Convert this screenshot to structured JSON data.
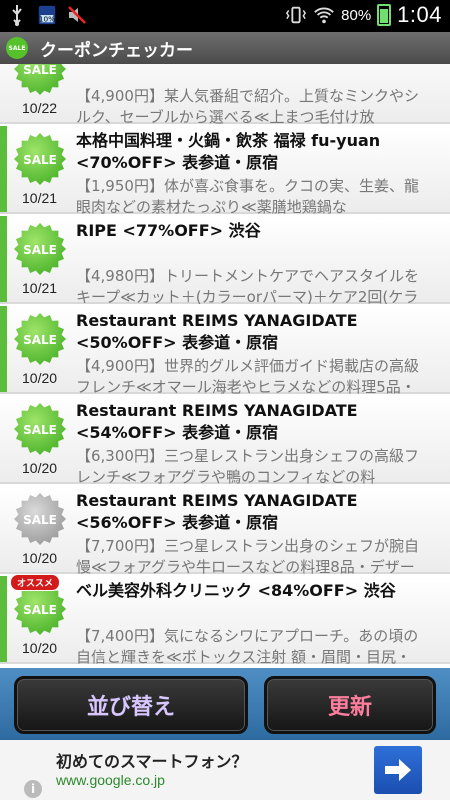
{
  "status_bar": {
    "battery_pct": "80%",
    "time": "1:04",
    "icons": [
      "usb-icon",
      "battery-widget-icon",
      "mute-icon",
      "vibrate-icon",
      "wifi-icon",
      "battery-icon"
    ]
  },
  "app": {
    "title": "クーポンチェッカー"
  },
  "colors": {
    "accent_green": "#5cbc3b",
    "header_gray": "#5a5a5a",
    "button_bar_blue": "#3b7bb3"
  },
  "items": [
    {
      "badge": "SALE",
      "badge_color": "green",
      "date": "10/22",
      "title": "",
      "desc_1": "【4,900円】某人気番組で紹介。上質なミンクやシ",
      "desc_2": "ルク、セーブルから選べる≪上まつ毛付け放",
      "stripe": false,
      "osusume": ""
    },
    {
      "badge": "SALE",
      "badge_color": "green",
      "date": "10/21",
      "title": "本格中国料理・火鍋・飲茶 福禄 fu-yuan <70%OFF> 表参道・原宿",
      "desc_1": "【1,950円】体が喜ぶ食事を。クコの実、生姜、龍",
      "desc_2": "眼肉などの素材たっぷり≪薬膳地鶏鍋な",
      "stripe": true,
      "osusume": ""
    },
    {
      "badge": "SALE",
      "badge_color": "green",
      "date": "10/21",
      "title": "RIPE <77%OFF> 渋谷",
      "desc_1": "【4,980円】トリートメントケアでヘアスタイルを",
      "desc_2": "キープ≪カット＋(カラーorパーマ)＋ケア2回(ケラ",
      "stripe": true,
      "osusume": ""
    },
    {
      "badge": "SALE",
      "badge_color": "green",
      "date": "10/20",
      "title": "Restaurant REIMS YANAGIDATE <50%OFF> 表参道・原宿",
      "desc_1": "【4,900円】世界的グルメ評価ガイド掲載店の高級",
      "desc_2": "フレンチ≪オマール海老やヒラメなどの料理5品・",
      "stripe": true,
      "osusume": ""
    },
    {
      "badge": "SALE",
      "badge_color": "green",
      "date": "10/20",
      "title": "Restaurant REIMS YANAGIDATE <54%OFF> 表参道・原宿",
      "desc_1": "【6,300円】三つ星レストラン出身シェフの高級フ",
      "desc_2": "レンチ≪フォアグラや鴨のコンフィなどの料",
      "stripe": false,
      "osusume": ""
    },
    {
      "badge": "SALE",
      "badge_color": "gray",
      "date": "10/20",
      "title": "Restaurant REIMS YANAGIDATE <56%OFF> 表参道・原宿",
      "desc_1": "【7,700円】三つ星レストラン出身のシェフが腕自",
      "desc_2": "慢≪フォアグラや牛ロースなどの料理8品・デザー",
      "stripe": false,
      "osusume": ""
    },
    {
      "badge": "SALE",
      "badge_color": "green",
      "date": "10/20",
      "title": "ベル美容外科クリニック <84%OFF> 渋谷",
      "desc_1": "【7,400円】気になるシワにアプローチ。あの頃の",
      "desc_2": "自信と輝きを≪ボトックス注射 額・眉間・目尻・",
      "stripe": true,
      "osusume": "オススメ"
    }
  ],
  "buttons": {
    "sort": "並び替え",
    "refresh": "更新"
  },
  "ad": {
    "title": "初めてのスマートフォン？",
    "url": "www.google.co.jp",
    "info": "i"
  }
}
